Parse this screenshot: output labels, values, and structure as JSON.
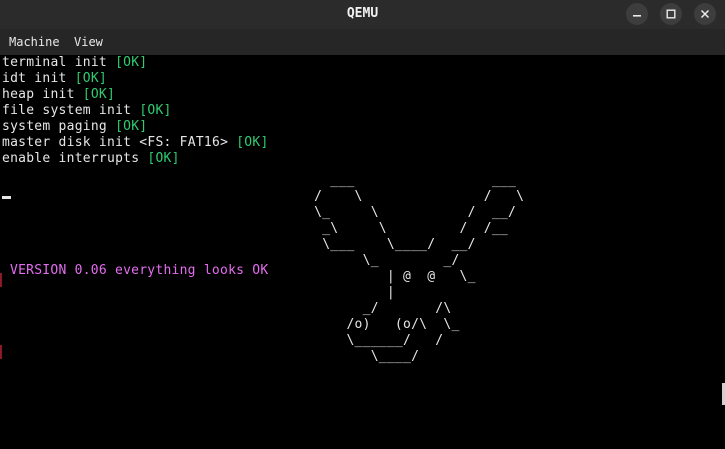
{
  "window": {
    "title": "QEMU",
    "controls": [
      "minimize-icon",
      "maximize-icon",
      "close-icon"
    ]
  },
  "menu": {
    "items": [
      "Machine",
      "View"
    ]
  },
  "console": {
    "boot_lines": [
      {
        "text": "terminal init ",
        "status": "[OK]"
      },
      {
        "text": "idt init ",
        "status": "[OK]"
      },
      {
        "text": "heap init ",
        "status": "[OK]"
      },
      {
        "text": "file system init ",
        "status": "[OK]"
      },
      {
        "text": "system paging ",
        "status": "[OK]"
      },
      {
        "text": "master disk init <FS: FAT16> ",
        "status": "[OK]"
      },
      {
        "text": "enable interrupts ",
        "status": "[OK]"
      }
    ],
    "version_text": "VERSION 0.06 everything looks OK",
    "ascii_art": "    ___                 ___\n  /    \\               /   \\\n  \\_     \\           /  __/\n   _\\     \\         /  /__\n   \\___    \\____/  __/\n        \\_        _/\n           | @  @   \\_\n           |\n        _/       /\\\n      /o)   (o/\\  \\_\n      \\______/   /\n         \\____/",
    "colors": {
      "text": "#e6e6e6",
      "ok": "#2ecc71",
      "version": "#e46df0",
      "background": "#000000"
    }
  }
}
